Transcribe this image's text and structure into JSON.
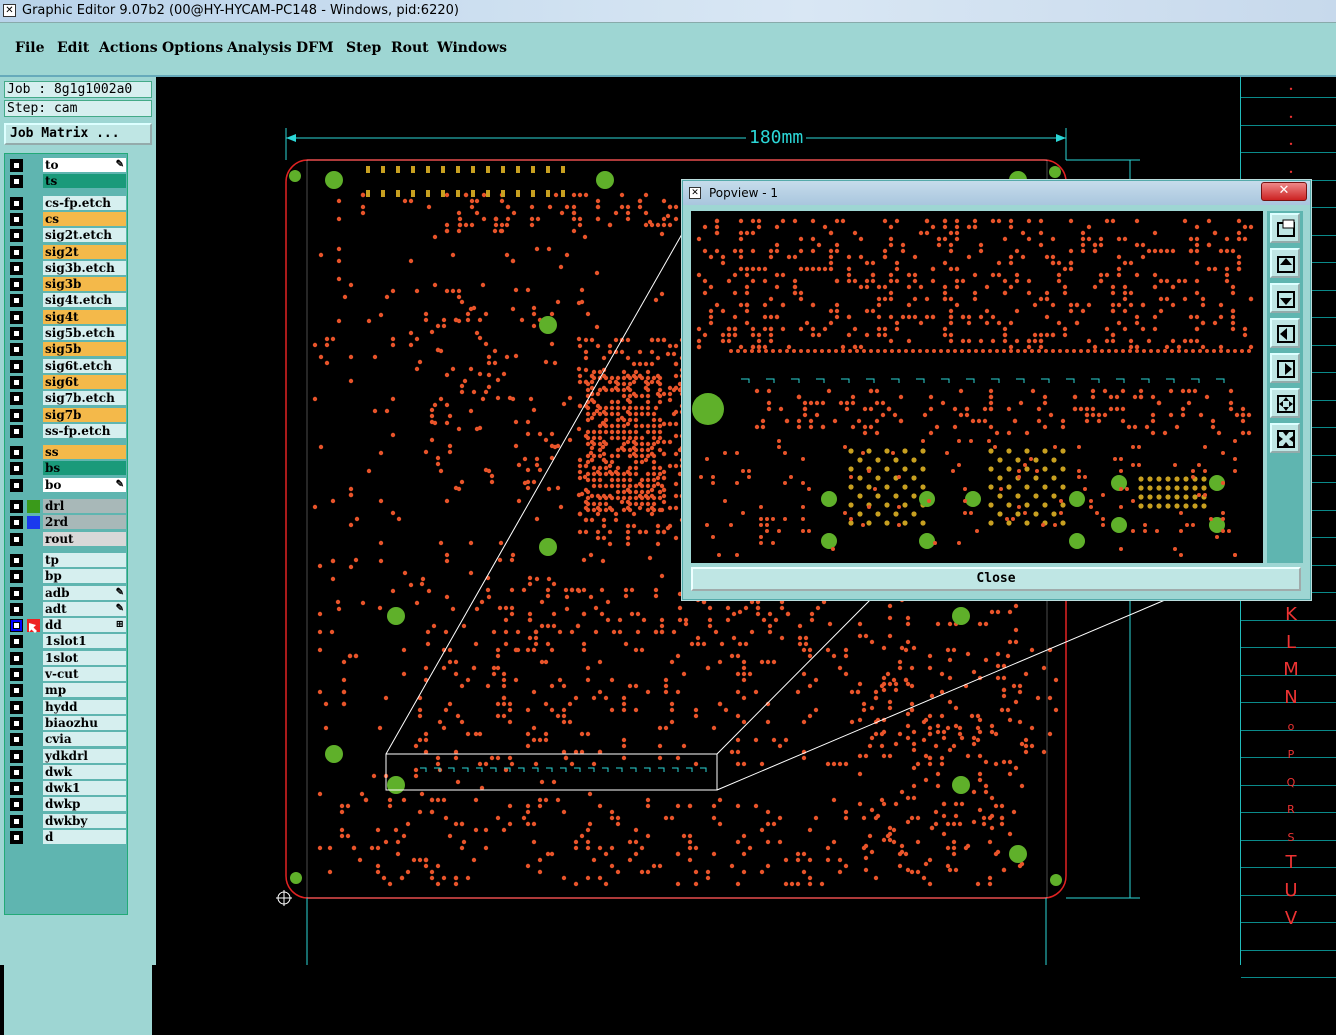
{
  "window": {
    "title": "Graphic Editor 9.07b2 (00@HY-HYCAM-PC148 - Windows, pid:6220)"
  },
  "menu": [
    "File",
    "Edit",
    "Actions",
    "Options",
    "Analysis",
    "DFM",
    "Step",
    "Rout",
    "Windows"
  ],
  "info": {
    "job": "Job : 8g1g1002a0",
    "step": "Step: cam",
    "job_matrix": "Job Matrix ..."
  },
  "layers": [
    {
      "name": "to",
      "color": "#ffffff",
      "mark": "brush"
    },
    {
      "name": "ts",
      "color": "#1a9a7a"
    },
    {
      "name": "cs-fp.etch",
      "color": "#d6efef"
    },
    {
      "name": "cs",
      "color": "#f4b94a"
    },
    {
      "name": "sig2t.etch",
      "color": "#d6efef"
    },
    {
      "name": "sig2t",
      "color": "#f4b94a"
    },
    {
      "name": "sig3b.etch",
      "color": "#d6efef"
    },
    {
      "name": "sig3b",
      "color": "#f4b94a"
    },
    {
      "name": "sig4t.etch",
      "color": "#d6efef"
    },
    {
      "name": "sig4t",
      "color": "#f4b94a"
    },
    {
      "name": "sig5b.etch",
      "color": "#d6efef"
    },
    {
      "name": "sig5b",
      "color": "#f4b94a"
    },
    {
      "name": "sig6t.etch",
      "color": "#d6efef"
    },
    {
      "name": "sig6t",
      "color": "#f4b94a"
    },
    {
      "name": "sig7b.etch",
      "color": "#d6efef"
    },
    {
      "name": "sig7b",
      "color": "#f4b94a"
    },
    {
      "name": "ss-fp.etch",
      "color": "#d6efef"
    },
    {
      "name": "ss",
      "color": "#f4b94a"
    },
    {
      "name": "bs",
      "color": "#1a9a7a"
    },
    {
      "name": "bo",
      "color": "#ffffff",
      "mark": "brush"
    },
    {
      "name": "drl",
      "color": "#a8b8b8",
      "swatch": "#3a9a1a"
    },
    {
      "name": "2rd",
      "color": "#a8b8b8",
      "swatch": "#1a3aee"
    },
    {
      "name": "rout",
      "color": "#d8d8d8"
    },
    {
      "name": "tp",
      "color": "#d6efef"
    },
    {
      "name": "bp",
      "color": "#d6efef"
    },
    {
      "name": "adb",
      "color": "#d6efef",
      "mark": "brush"
    },
    {
      "name": "adt",
      "color": "#d6efef",
      "mark": "brush"
    },
    {
      "name": "dd",
      "color": "#d6efef",
      "mark": "grid",
      "swatch": "#e22",
      "active": true
    },
    {
      "name": "1slot1",
      "color": "#d6efef"
    },
    {
      "name": "1slot",
      "color": "#d6efef"
    },
    {
      "name": "v-cut",
      "color": "#d6efef"
    },
    {
      "name": "mp",
      "color": "#d6efef"
    },
    {
      "name": "hydd",
      "color": "#d6efef"
    },
    {
      "name": "biaozhu",
      "color": "#d6efef"
    },
    {
      "name": "cvia",
      "color": "#d6efef"
    },
    {
      "name": "ydkdrl",
      "color": "#d6efef"
    },
    {
      "name": "dwk",
      "color": "#d6efef"
    },
    {
      "name": "dwk1",
      "color": "#d6efef"
    },
    {
      "name": "dwkp",
      "color": "#d6efef"
    },
    {
      "name": "dwkby",
      "color": "#d6efef"
    },
    {
      "name": "d",
      "color": "#d6efef"
    }
  ],
  "canvas": {
    "dimension_label": "180mm",
    "pad_color": "#e8542a",
    "fiducial_color": "#5fb02a",
    "outline_color": "#e22222",
    "dim_color": "#2bd6d6"
  },
  "ruler_letters": [
    "K",
    "L",
    "M",
    "N",
    "o",
    "P",
    "Q",
    "R",
    "S",
    "T",
    "U",
    "V"
  ],
  "popview": {
    "title": "Popview - 1",
    "close_label": "Close",
    "close_x": "✕"
  }
}
